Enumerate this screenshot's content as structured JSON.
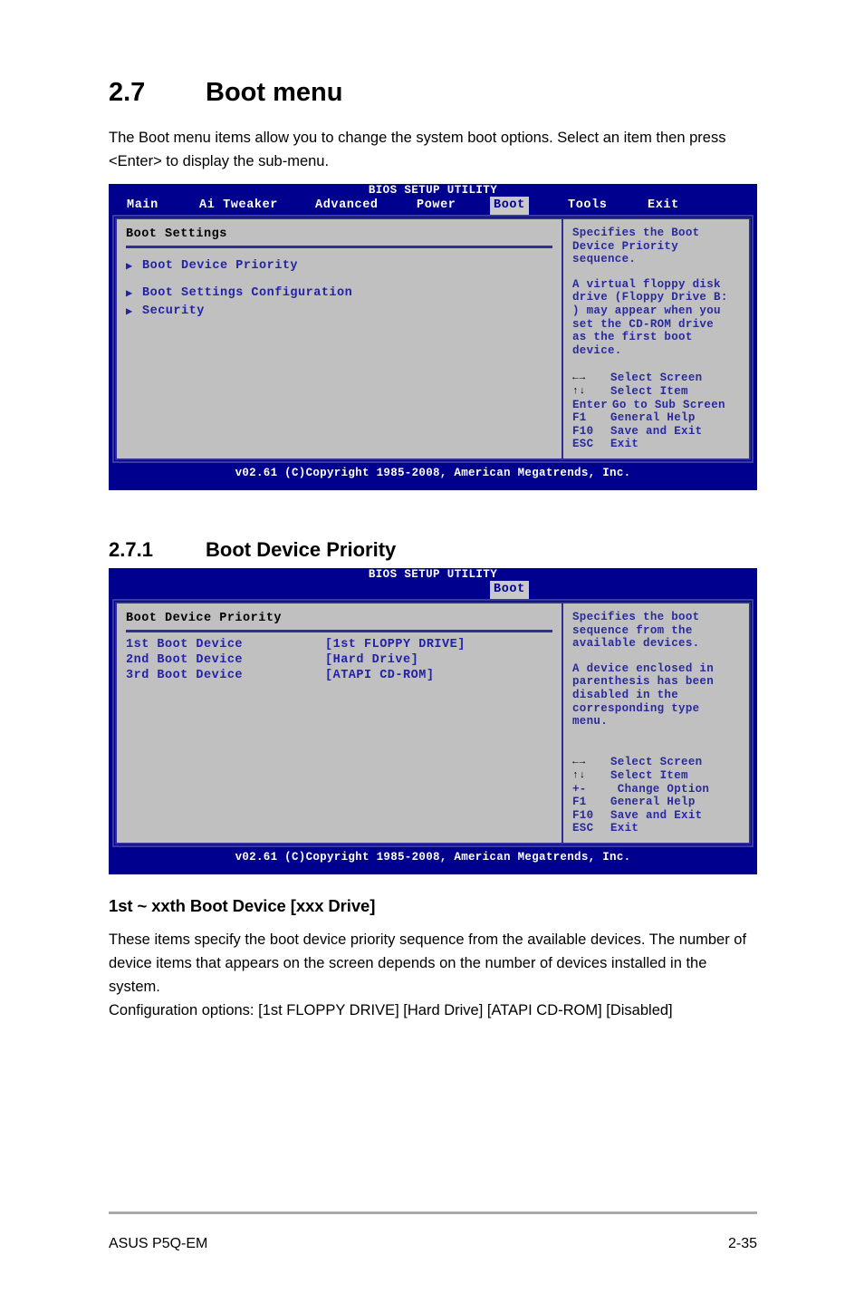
{
  "document": {
    "section": {
      "number": "2.7",
      "title": "Boot menu",
      "intro": "The Boot menu items allow you to change the system boot options. Select an item then press <Enter> to display the sub-menu."
    },
    "subsection": {
      "number": "2.7.1",
      "title": "Boot Device Priority"
    },
    "item_heading": "1st ~ xxth Boot Device [xxx Drive]",
    "item_description": "These items specify the boot device priority sequence from the available devices. The number of device items that appears on the screen depends on the number of devices installed in the system.",
    "item_config_options": "Configuration options: [1st FLOPPY DRIVE] [Hard Drive] [ATAPI CD-ROM] [Disabled]",
    "footer": {
      "left": "ASUS P5Q-EM",
      "right": "2-35"
    }
  },
  "bios_screen_1": {
    "title": "BIOS SETUP UTILITY",
    "menu_items": [
      {
        "label": "Main",
        "active": false
      },
      {
        "label": "Ai Tweaker",
        "active": false
      },
      {
        "label": "Advanced",
        "active": false
      },
      {
        "label": "Power",
        "active": false
      },
      {
        "label": "Boot",
        "active": true
      },
      {
        "label": "Tools",
        "active": false
      },
      {
        "label": "Exit",
        "active": false
      }
    ],
    "panel_title": "Boot Settings",
    "menu_entries": [
      {
        "label": "Boot Device Priority",
        "arrow": "▶"
      },
      {
        "label": "Boot Settings Configuration",
        "arrow": "▶"
      },
      {
        "label": "Security",
        "arrow": "▶"
      }
    ],
    "help_paragraphs": [
      "Specifies the Boot\nDevice Priority\nsequence.",
      "A virtual floppy disk\ndrive (Floppy Drive B:\n) may appear when you\nset the CD-ROM drive\nas the first boot\ndevice."
    ],
    "legend": [
      {
        "key": "←→",
        "action": "Select Screen",
        "glyph": true
      },
      {
        "key": "↑↓",
        "action": "Select Item",
        "glyph": true
      },
      {
        "key": "Enter",
        "action": "Go to Sub Screen",
        "glyph": false,
        "full": true
      },
      {
        "key": "F1",
        "action": "General Help",
        "glyph": false
      },
      {
        "key": "F10",
        "action": "Save and Exit",
        "glyph": false
      },
      {
        "key": "ESC",
        "action": "Exit",
        "glyph": false
      }
    ],
    "footer": "v02.61 (C)Copyright 1985-2008, American Megatrends, Inc."
  },
  "bios_screen_2": {
    "title": "BIOS SETUP UTILITY",
    "active_tab": "Boot",
    "panel_title": "Boot Device Priority",
    "rows": [
      {
        "label": "1st Boot Device",
        "value": "[1st FLOPPY DRIVE]"
      },
      {
        "label": "2nd Boot Device",
        "value": "[Hard Drive]"
      },
      {
        "label": "3rd Boot Device",
        "value": "[ATAPI CD-ROM]"
      }
    ],
    "help_paragraphs": [
      "Specifies the boot\nsequence from the\navailable devices.",
      "A device enclosed in\nparenthesis has been\ndisabled in the\ncorresponding type\nmenu."
    ],
    "legend": [
      {
        "key": "←→",
        "action": "Select Screen",
        "glyph": true
      },
      {
        "key": "↑↓",
        "action": "Select Item",
        "glyph": true
      },
      {
        "key": "+-",
        "action": " Change Option",
        "glyph": false
      },
      {
        "key": "F1",
        "action": "General Help",
        "glyph": false
      },
      {
        "key": "F10",
        "action": "Save and Exit",
        "glyph": false
      },
      {
        "key": "ESC",
        "action": "Exit",
        "glyph": false
      }
    ],
    "footer": "v02.61 (C)Copyright 1985-2008, American Megatrends, Inc."
  },
  "colors": {
    "bios_blue": "#00008f",
    "bios_panel": "#c0c0c0",
    "bios_text_blue": "#2222a8",
    "bios_border": "#2e2e96",
    "highlight_bg": "#c8c8c8"
  }
}
